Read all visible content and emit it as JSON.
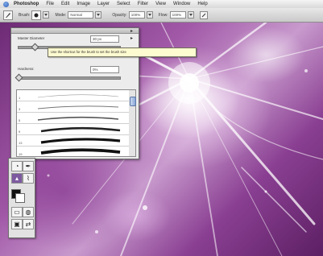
{
  "menubar": {
    "items": [
      "Photoshop",
      "File",
      "Edit",
      "Image",
      "Layer",
      "Select",
      "Filter",
      "View",
      "Window",
      "Help"
    ]
  },
  "options_bar": {
    "mode_label": "Mode:",
    "mode_value": "Normal",
    "opacity_label": "Opacity:",
    "opacity_value": "100%",
    "flow_label": "Flow:",
    "flow_value": "100%"
  },
  "brushes_palette": {
    "diameter_label": "Master Diameter",
    "diameter_value": "30 px",
    "hardness_label": "Hardness:",
    "hardness_value": "0%",
    "brush_numbers": [
      "1",
      "3",
      "5",
      "9",
      "13",
      "19"
    ]
  },
  "tooltip": {
    "text": "Use the shortcut for the brush to set the brush size"
  },
  "colors": {
    "canvas_accent": "#a25aa8",
    "tooltip_bg": "#fdfbd0",
    "palette_bg": "#ececec"
  }
}
